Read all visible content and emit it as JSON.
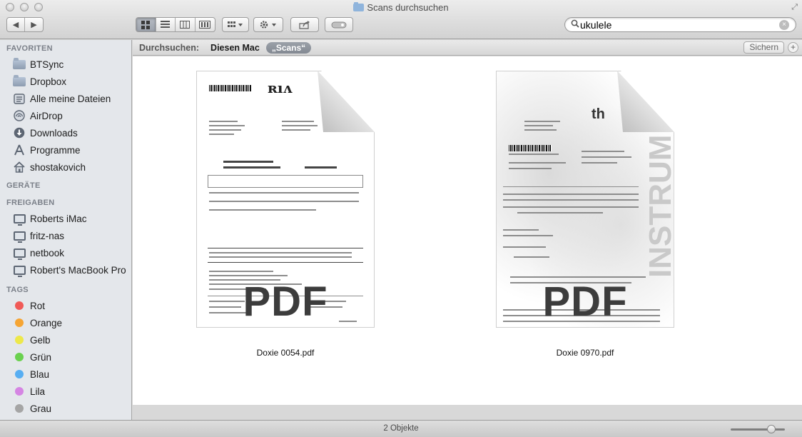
{
  "window": {
    "title": "Scans durchsuchen"
  },
  "toolbar": {
    "nav": {
      "back": "◀",
      "forward": "▶"
    },
    "view_modes": [
      "icon",
      "list",
      "columns",
      "cover-flow"
    ],
    "active_view": "icon"
  },
  "search": {
    "value": "ukulele",
    "clear_symbol": "×"
  },
  "sidebar": {
    "favorites_header": "FAVORITEN",
    "favorites": [
      {
        "label": "BTSync",
        "icon": "folder-icon"
      },
      {
        "label": "Dropbox",
        "icon": "folder-icon"
      },
      {
        "label": "Alle meine Dateien",
        "icon": "all-files-icon"
      },
      {
        "label": "AirDrop",
        "icon": "airdrop-icon"
      },
      {
        "label": "Downloads",
        "icon": "downloads-icon"
      },
      {
        "label": "Programme",
        "icon": "applications-icon"
      },
      {
        "label": "shostakovich",
        "icon": "home-icon"
      }
    ],
    "devices_header": "GERÄTE",
    "shared_header": "FREIGABEN",
    "shared": [
      {
        "label": "Roberts iMac",
        "icon": "computer-icon"
      },
      {
        "label": "fritz-nas",
        "icon": "computer-icon"
      },
      {
        "label": "netbook",
        "icon": "computer-icon"
      },
      {
        "label": "Robert's MacBook Pro",
        "icon": "computer-icon"
      }
    ],
    "tags_header": "TAGS",
    "tags": [
      {
        "label": "Rot",
        "color": "#f05a57"
      },
      {
        "label": "Orange",
        "color": "#f6a533"
      },
      {
        "label": "Gelb",
        "color": "#ede84a"
      },
      {
        "label": "Grün",
        "color": "#6ad14f"
      },
      {
        "label": "Blau",
        "color": "#57aef2"
      },
      {
        "label": "Lila",
        "color": "#d585e3"
      },
      {
        "label": "Grau",
        "color": "#a5a5a5"
      }
    ]
  },
  "scopebar": {
    "label": "Durchsuchen:",
    "option_this_mac": "Diesen Mac",
    "option_folder": "„Scans“",
    "save_label": "Sichern",
    "add_label": "+"
  },
  "files": [
    {
      "name": "Doxie 0054.pdf",
      "type_label": "PDF"
    },
    {
      "name": "Doxie 0970.pdf",
      "type_label": "PDF"
    }
  ],
  "statusbar": {
    "count_text": "2 Objekte",
    "icon_size_level": 0.8
  }
}
